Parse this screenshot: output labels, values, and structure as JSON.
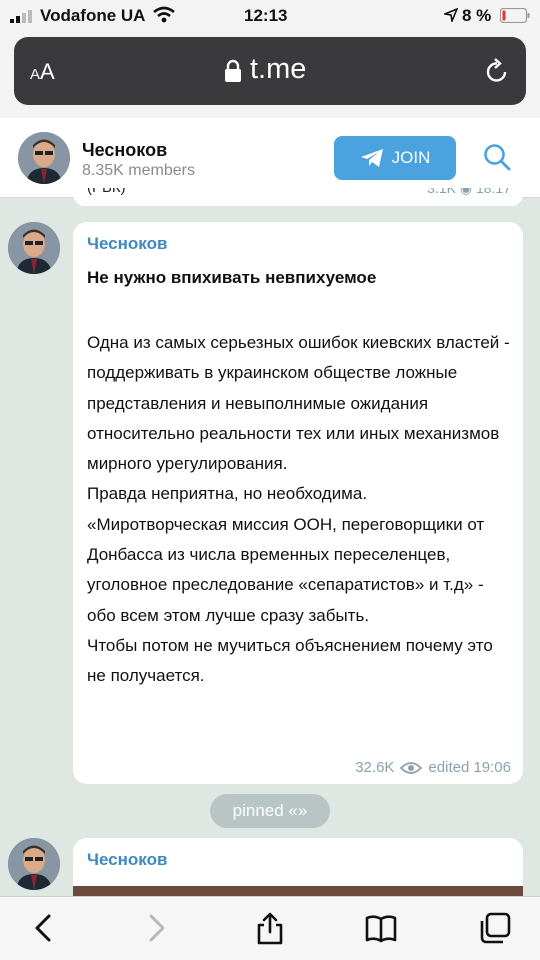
{
  "status_bar": {
    "carrier": "Vodafone UA",
    "time": "12:13",
    "battery": "8 %"
  },
  "browser": {
    "text_size_label_small": "A",
    "text_size_label_large": "A",
    "domain": "t.me"
  },
  "channel": {
    "title": "Чесноков",
    "members": "8.35K members",
    "join_label": "JOIN"
  },
  "previous_message": {
    "text": "(РБК)",
    "views": "3.1K",
    "time": "18:17"
  },
  "message": {
    "author": "Чесноков",
    "headline": "Не нужно впихивать невпихуемое",
    "paragraphs": [
      "Одна из самых серьезных ошибок киевских властей - поддерживать в украинском обществе ложные представления и невыполнимые ожидания относительно реальности тех или иных механизмов мирного урегулирования.",
      "Правда неприятна, но необходима.",
      "«Миротворческая миссия ООН, переговорщики от Донбасса из числа временных переселенцев, уголовное преследование «сепаратистов» и т.д» - обо всем этом лучше сразу забыть.",
      "Чтобы потом не мучиться объяснением почему это не получается."
    ],
    "views": "32.6K",
    "edited_time": "edited  19:06"
  },
  "pinned_label": "pinned «»",
  "next_message": {
    "author": "Чесноков"
  },
  "colors": {
    "accent": "#4aa3df",
    "author": "#3e88c4",
    "chat_background": "#dfe7e3"
  },
  "icons": {
    "back": "chevron-left-icon",
    "forward": "chevron-right-icon",
    "share": "share-icon",
    "bookmarks": "book-icon",
    "tabs": "tabs-icon"
  }
}
